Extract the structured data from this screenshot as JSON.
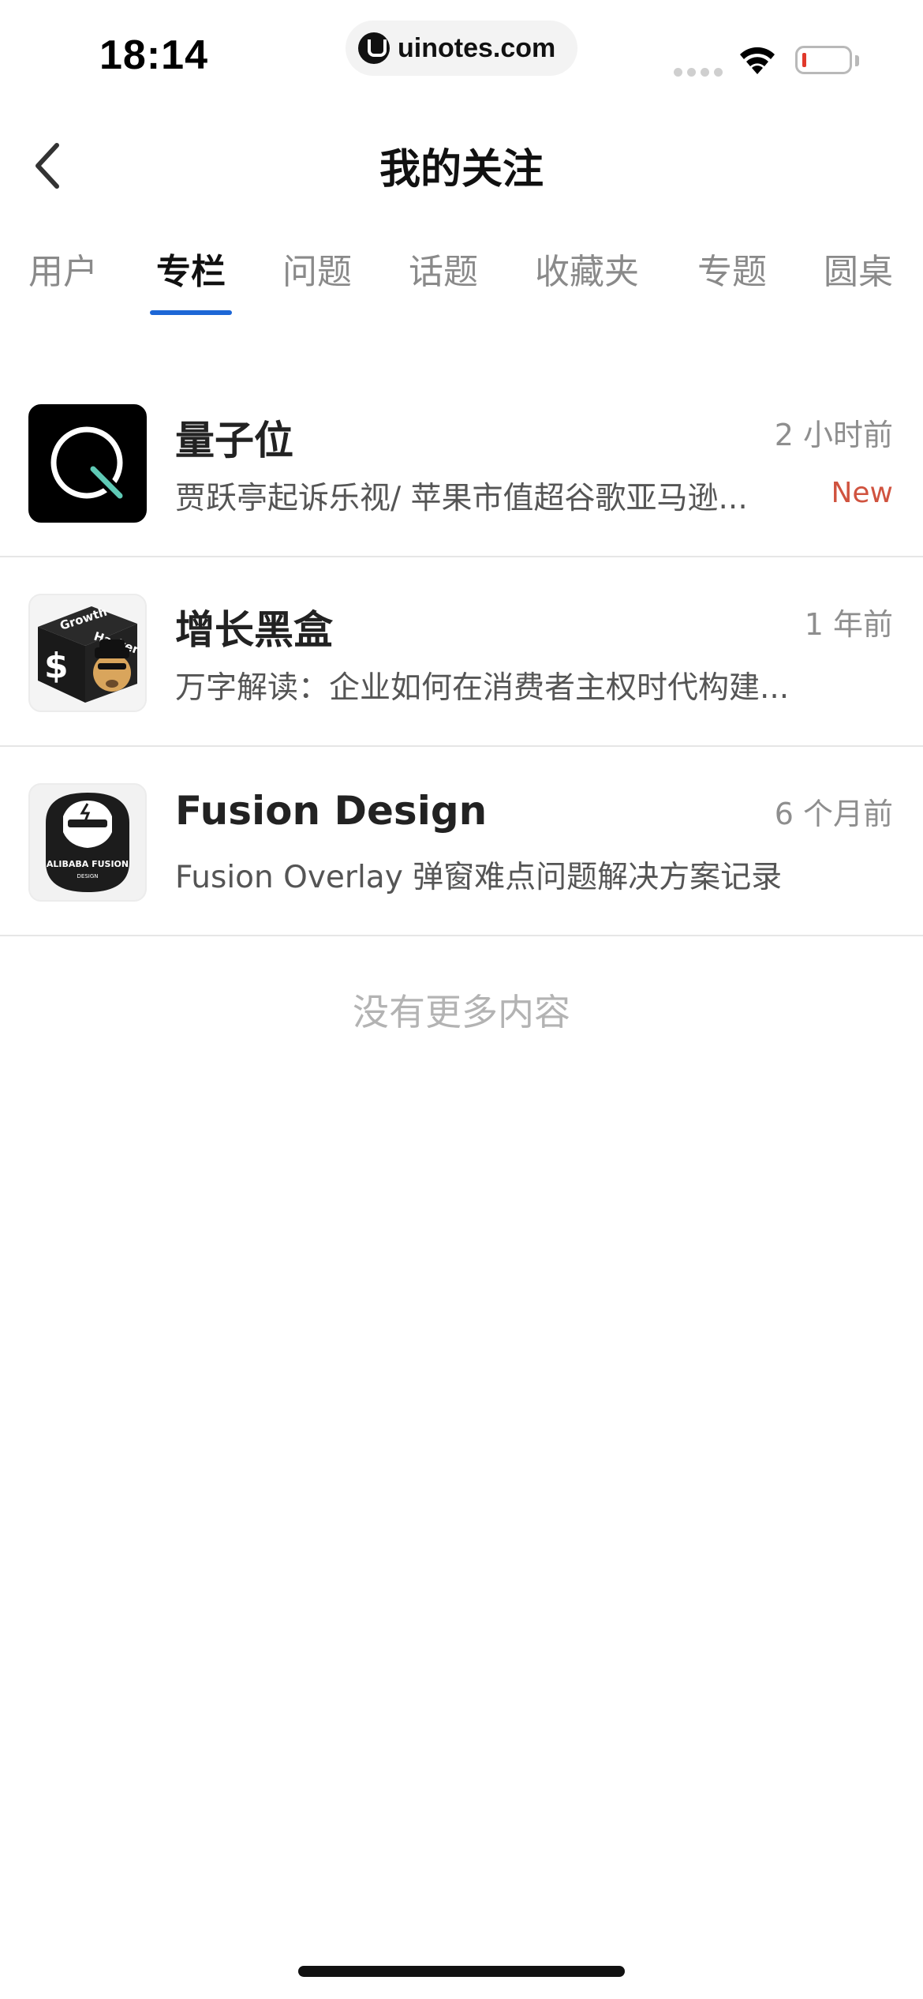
{
  "status_bar": {
    "time": "18:14",
    "url": "uinotes.com"
  },
  "nav": {
    "title": "我的关注",
    "back_icon": "chevron-left-icon"
  },
  "tabs": [
    {
      "label": "用户",
      "active": false
    },
    {
      "label": "专栏",
      "active": true
    },
    {
      "label": "问题",
      "active": false
    },
    {
      "label": "话题",
      "active": false
    },
    {
      "label": "收藏夹",
      "active": false
    },
    {
      "label": "专题",
      "active": false
    },
    {
      "label": "圆桌",
      "active": false
    }
  ],
  "columns": [
    {
      "name": "量子位",
      "time": "2 小时前",
      "desc": "贾跃亭起诉乐视/ 苹果市值超谷歌亚马逊...",
      "badge": "New"
    },
    {
      "name": "增长黑盒",
      "time": "1 年前",
      "desc": "万字解读：企业如何在消费者主权时代构建...",
      "avatar_text": [
        "Growth",
        "Hacker"
      ]
    },
    {
      "name": "Fusion Design",
      "time": "6 个月前",
      "desc": "Fusion Overlay 弹窗难点问题解决方案记录",
      "avatar_text": [
        "ALIBABA FUSION",
        "DESIGN"
      ]
    }
  ],
  "footer": {
    "no_more": "没有更多内容"
  },
  "colors": {
    "tab_underline": "#1d67d6",
    "badge": "#d0533f"
  }
}
